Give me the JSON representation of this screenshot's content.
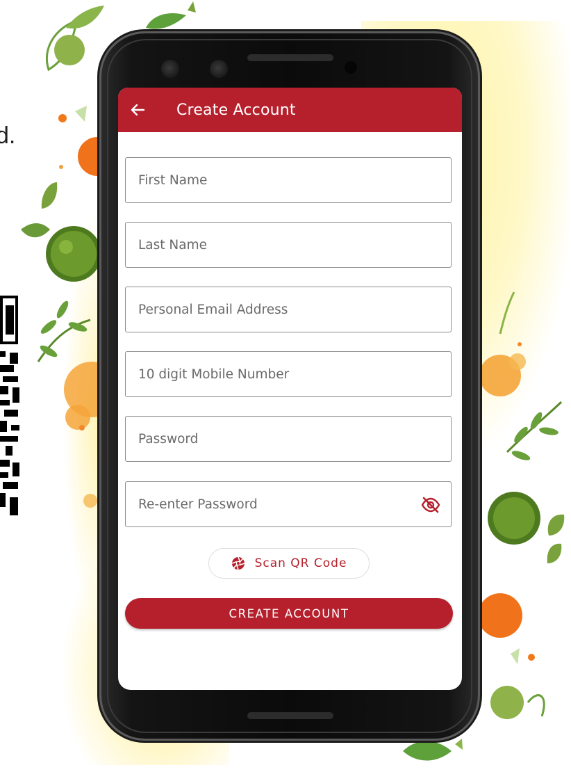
{
  "background": {
    "partial_text": "d."
  },
  "appbar": {
    "title": "Create Account",
    "back_icon": "arrow-left-icon",
    "color": "#b5202c"
  },
  "form": {
    "fields": [
      {
        "name": "first-name-input",
        "placeholder": "First Name",
        "value": ""
      },
      {
        "name": "last-name-input",
        "placeholder": "Last Name",
        "value": ""
      },
      {
        "name": "email-input",
        "placeholder": "Personal Email Address",
        "value": ""
      },
      {
        "name": "mobile-input",
        "placeholder": "10 digit Mobile Number",
        "value": ""
      },
      {
        "name": "password-input",
        "placeholder": "Password",
        "value": ""
      },
      {
        "name": "reenter-password-input",
        "placeholder": "Re-enter Password",
        "value": ""
      }
    ],
    "password_toggle_icon": "eye-off-icon"
  },
  "scan_button": {
    "label": "Scan QR Code",
    "icon": "camera-shutter-icon"
  },
  "create_button": {
    "label": "CREATE ACCOUNT"
  }
}
